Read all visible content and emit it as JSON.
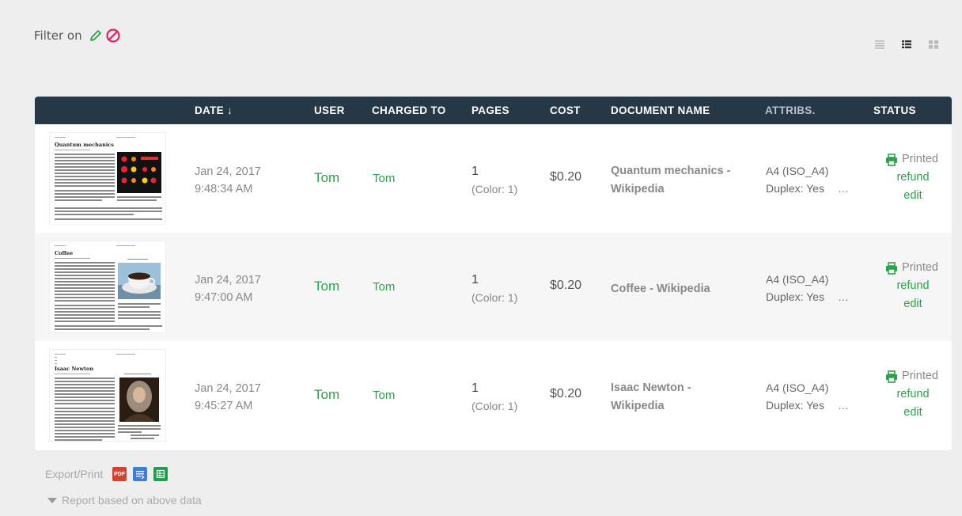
{
  "filter": {
    "label": "Filter on",
    "edit_icon": "pencil-icon",
    "clear_icon": "no-entry-icon"
  },
  "view_modes": [
    "list-view-icon",
    "detail-view-icon",
    "grid-view-icon"
  ],
  "columns": {
    "date": "DATE ↓",
    "user": "USER",
    "charged_to": "CHARGED TO",
    "pages": "PAGES",
    "cost": "COST",
    "document_name": "DOCUMENT NAME",
    "attribs": "ATTRIBS.",
    "status": "STATUS"
  },
  "rows": [
    {
      "thumb_title": "Quantum mechanics",
      "date": "Jan 24, 2017",
      "time": "9:48:34 AM",
      "user": "Tom",
      "charged_to": "Tom",
      "pages": "1",
      "pages_color": "(Color: 1)",
      "cost": "$0.20",
      "document_name": "Quantum mechanics - Wikipedia",
      "attr_paper": "A4 (ISO_A4)",
      "attr_duplex": "Duplex: Yes",
      "attr_more": "…",
      "status": "Printed",
      "refund": "refund",
      "edit": "edit"
    },
    {
      "thumb_title": "Coffee",
      "date": "Jan 24, 2017",
      "time": "9:47:00 AM",
      "user": "Tom",
      "charged_to": "Tom",
      "pages": "1",
      "pages_color": "(Color: 1)",
      "cost": "$0.20",
      "document_name": "Coffee - Wikipedia",
      "attr_paper": "A4 (ISO_A4)",
      "attr_duplex": "Duplex: Yes",
      "attr_more": "…",
      "status": "Printed",
      "refund": "refund",
      "edit": "edit"
    },
    {
      "thumb_title": "Isaac Newton",
      "date": "Jan 24, 2017",
      "time": "9:45:27 AM",
      "user": "Tom",
      "charged_to": "Tom",
      "pages": "1",
      "pages_color": "(Color: 1)",
      "cost": "$0.20",
      "document_name": "Isaac Newton - Wikipedia",
      "attr_paper": "A4 (ISO_A4)",
      "attr_duplex": "Duplex: Yes",
      "attr_more": "…",
      "status": "Printed",
      "refund": "refund",
      "edit": "edit"
    }
  ],
  "export": {
    "label": "Export/Print",
    "pdf_label": "PDF",
    "icons": [
      "pdf-icon",
      "list-doc-icon",
      "spreadsheet-icon"
    ]
  },
  "report": {
    "label": "Report based on above data"
  },
  "colors": {
    "header_bg": "#263746",
    "green": "#2ca24a",
    "pdf_red": "#d9412b",
    "doc_blue": "#3d7de0",
    "sheet_green": "#1e9e4b"
  }
}
